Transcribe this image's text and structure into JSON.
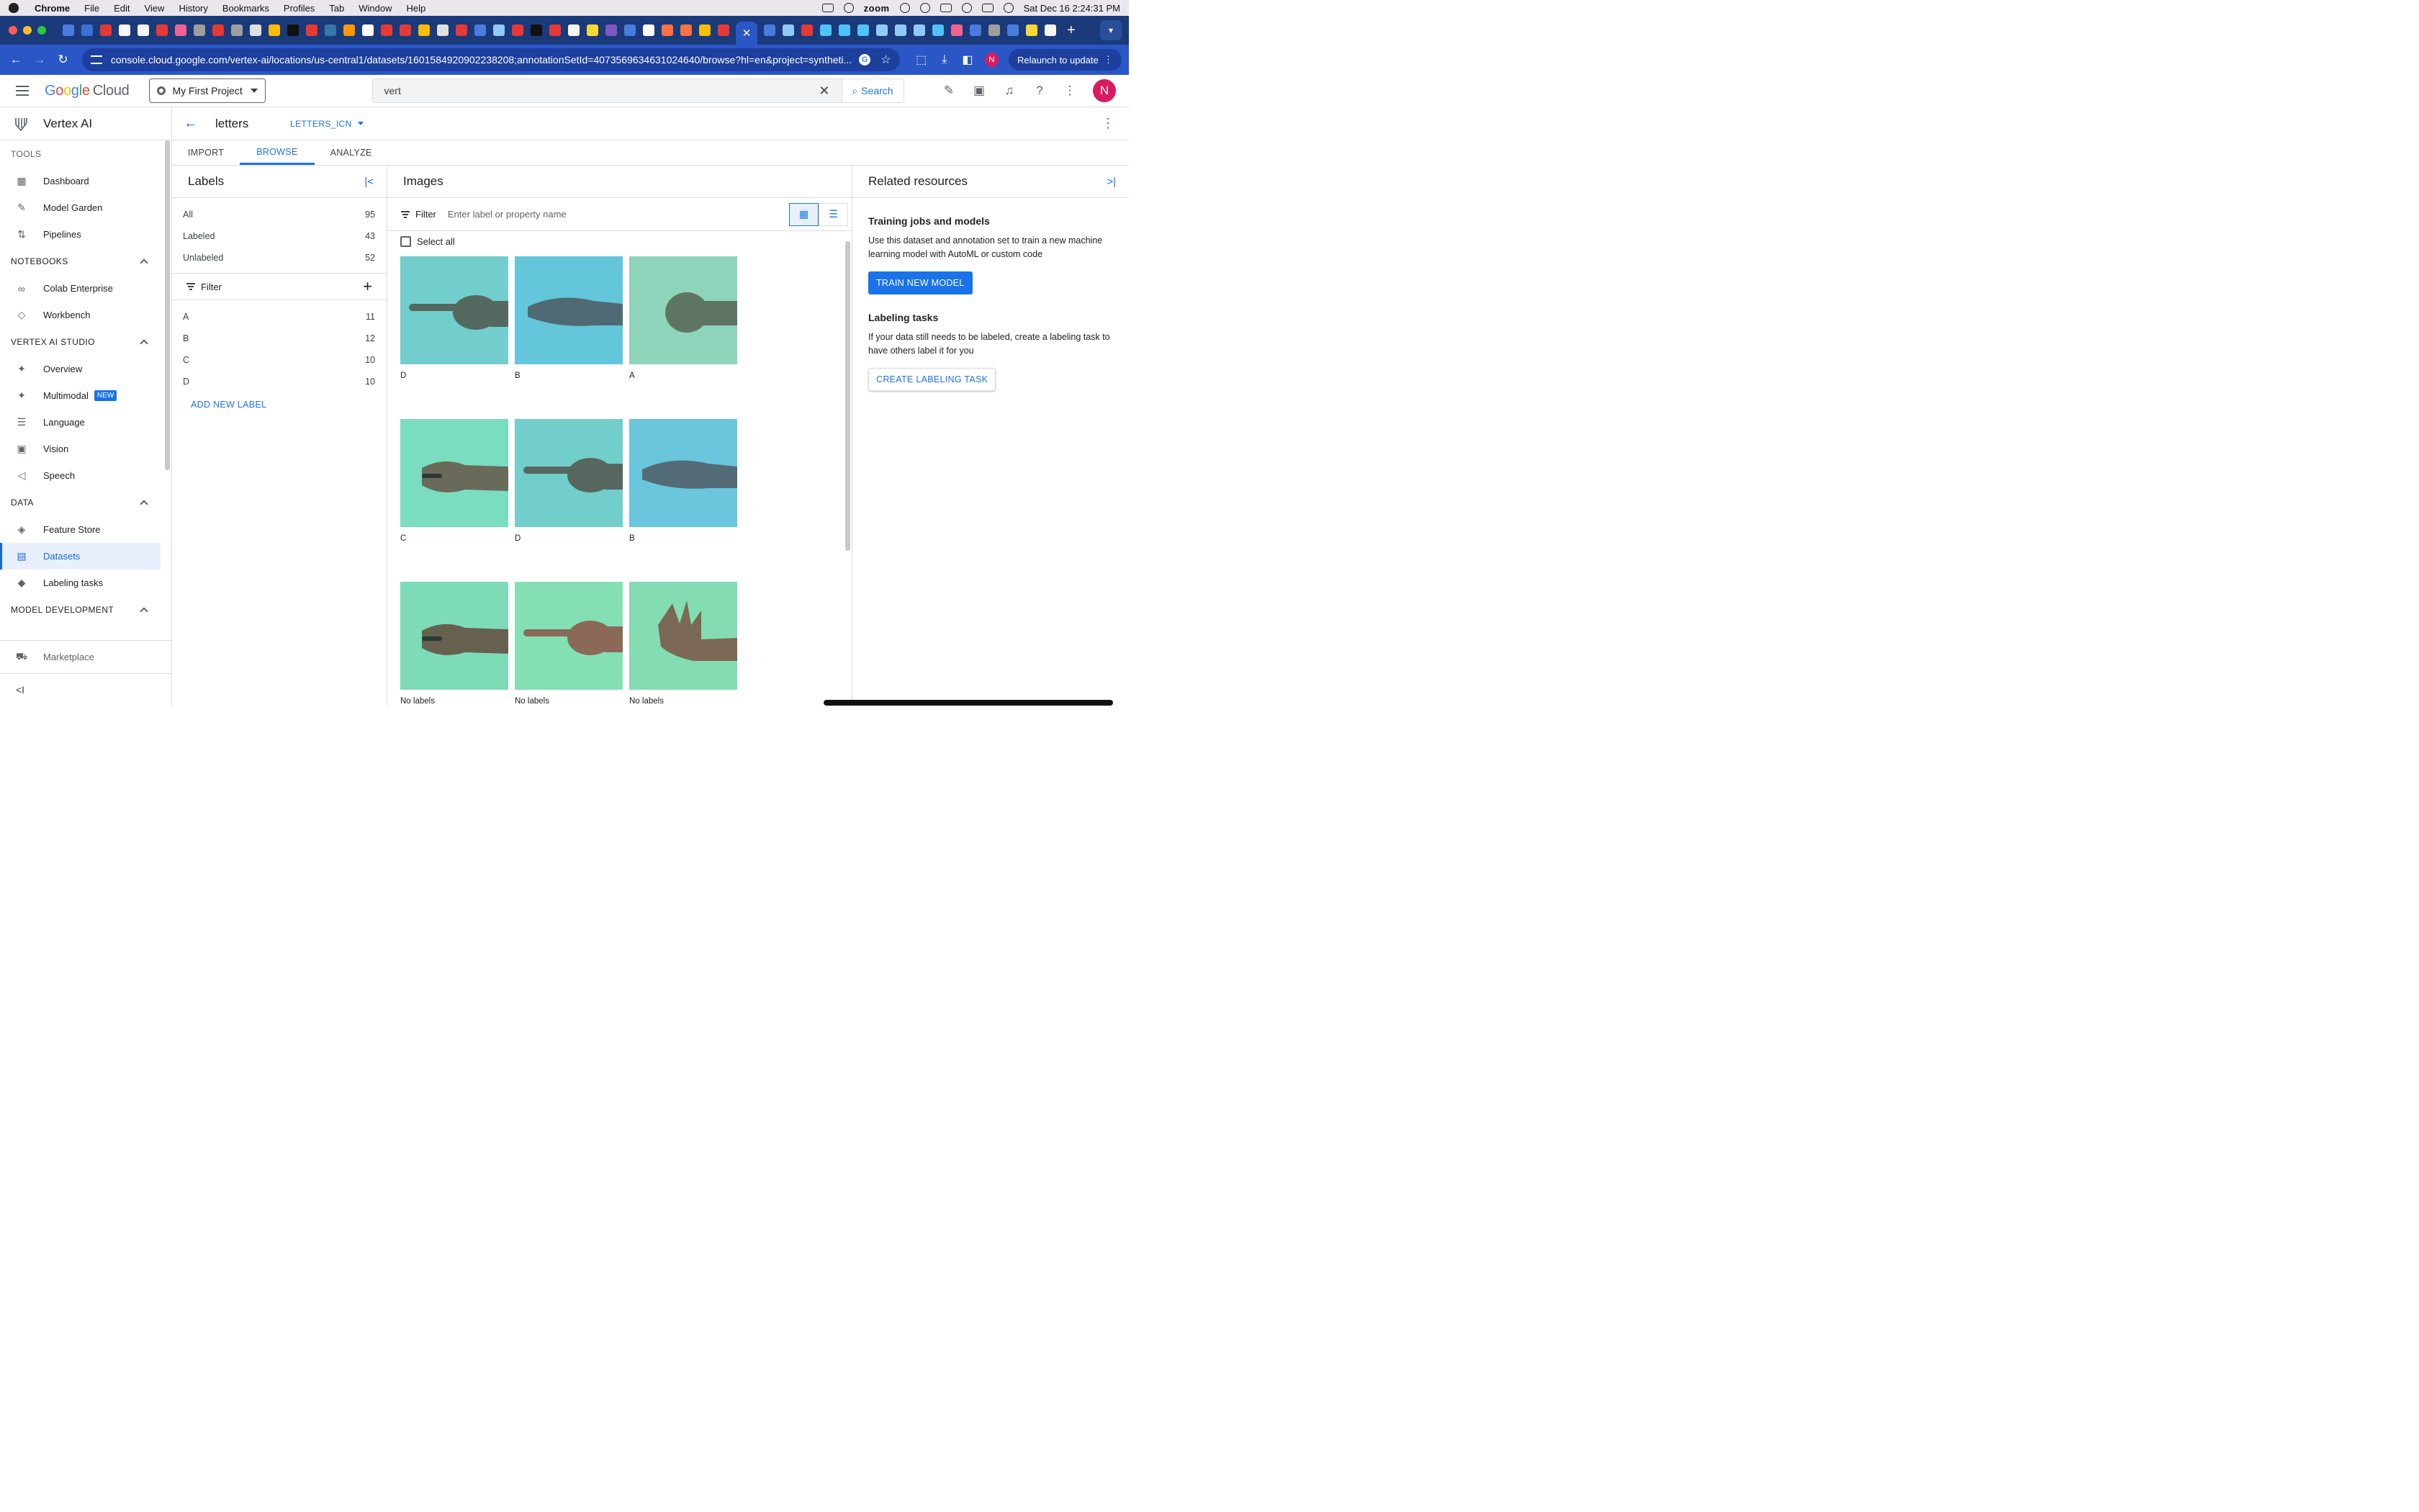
{
  "menubar": {
    "app": "Chrome",
    "menus": [
      "File",
      "Edit",
      "View",
      "History",
      "Bookmarks",
      "Profiles",
      "Tab",
      "Window",
      "Help"
    ],
    "zoom": "zoom",
    "datetime": "Sat Dec 16  2:24:31 PM"
  },
  "browser": {
    "url": "console.cloud.google.com/vertex-ai/locations/us-central1/datasets/1601584920902238208;annotationSetId=4073569634631024640/browse?hl=en&project=syntheti...",
    "relaunch": "Relaunch to update",
    "profile_initial": "N",
    "tab_close": "✕",
    "tab_new": "+"
  },
  "header": {
    "logo_google": "Google",
    "logo_cloud": "Cloud",
    "project": "My First Project",
    "search_value": "vert",
    "search_button": "Search",
    "user_initial": "N"
  },
  "leftnav": {
    "title": "Vertex AI",
    "tools_label": "TOOLS",
    "tools": [
      {
        "label": "Dashboard",
        "icon": "▦"
      },
      {
        "label": "Model Garden",
        "icon": "✎"
      },
      {
        "label": "Pipelines",
        "icon": "⇅"
      }
    ],
    "notebooks_label": "NOTEBOOKS",
    "notebooks": [
      {
        "label": "Colab Enterprise",
        "icon": "∞"
      },
      {
        "label": "Workbench",
        "icon": "◇"
      }
    ],
    "studio_label": "VERTEX AI STUDIO",
    "studio": [
      {
        "label": "Overview",
        "icon": "✦"
      },
      {
        "label": "Multimodal",
        "icon": "✦",
        "badge": "NEW"
      },
      {
        "label": "Language",
        "icon": "☰"
      },
      {
        "label": "Vision",
        "icon": "▣"
      },
      {
        "label": "Speech",
        "icon": "◁"
      }
    ],
    "data_label": "DATA",
    "data": [
      {
        "label": "Feature Store",
        "icon": "◈"
      },
      {
        "label": "Datasets",
        "icon": "▤"
      },
      {
        "label": "Labeling tasks",
        "icon": "◆"
      }
    ],
    "modeldev_label": "MODEL DEVELOPMENT",
    "marketplace": "Marketplace",
    "collapse": "<I"
  },
  "page": {
    "dataset_name": "letters",
    "annotation_set": "LETTERS_ICN",
    "tabs": [
      "IMPORT",
      "BROWSE",
      "ANALYZE"
    ],
    "active_tab": "BROWSE"
  },
  "labels_panel": {
    "title": "Labels",
    "summary": [
      {
        "label": "All",
        "count": "95"
      },
      {
        "label": "Labeled",
        "count": "43"
      },
      {
        "label": "Unlabeled",
        "count": "52"
      }
    ],
    "filter": "Filter",
    "labels": [
      {
        "label": "A",
        "count": "11"
      },
      {
        "label": "B",
        "count": "12"
      },
      {
        "label": "C",
        "count": "10"
      },
      {
        "label": "D",
        "count": "10"
      }
    ],
    "add_label": "ADD NEW LABEL"
  },
  "images_panel": {
    "title": "Images",
    "filter": "Filter",
    "filter_placeholder": "Enter label or property name",
    "select_all": "Select all",
    "items": [
      {
        "label": "D",
        "bg": "#5fc7c6",
        "skin": "#53685f",
        "pose": "point"
      },
      {
        "label": "B",
        "bg": "#4fbfd7",
        "skin": "#4f6a72",
        "pose": "flat"
      },
      {
        "label": "A",
        "bg": "#7fcfb2",
        "skin": "#5e7564",
        "pose": "fist"
      },
      {
        "label": "C",
        "bg": "#68d9b7",
        "skin": "#6a6a5a",
        "pose": "cup"
      },
      {
        "label": "D",
        "bg": "#5ec8c3",
        "skin": "#56675f",
        "pose": "point"
      },
      {
        "label": "B",
        "bg": "#55bfd8",
        "skin": "#536b76",
        "pose": "flat"
      },
      {
        "label": "No labels",
        "bg": "#6cd8ae",
        "skin": "#66604f",
        "pose": "cup"
      },
      {
        "label": "No labels",
        "bg": "#73dcaa",
        "skin": "#8a6a56",
        "pose": "point"
      },
      {
        "label": "No labels",
        "bg": "#74d8a8",
        "skin": "#7b6855",
        "pose": "spread"
      }
    ]
  },
  "related": {
    "title": "Related resources",
    "training_heading": "Training jobs and models",
    "training_text": "Use this dataset and annotation set to train a new machine learning model with AutoML or custom code",
    "train_button": "TRAIN NEW MODEL",
    "labeling_heading": "Labeling tasks",
    "labeling_text": "If your data still needs to be labeled, create a labeling task to have others label it for you",
    "labeling_button": "CREATE LABELING TASK"
  },
  "colors": {
    "accent": "#1a73e8",
    "chrome_frame": "#1a3a7a",
    "chrome_toolbar": "#2a56c6"
  }
}
